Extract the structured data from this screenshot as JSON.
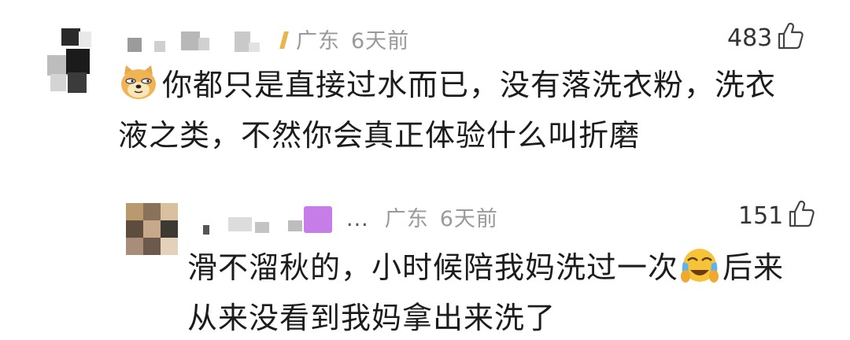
{
  "comments": [
    {
      "location": "广东",
      "time": "6天前",
      "likes": "483",
      "text_line1": "你都只是直接过水而已，没有落洗衣粉，洗衣",
      "text_line2": "液之类，不然你会真正体验什么叫折磨",
      "leading_emoji": "doge-emoji-icon"
    }
  ],
  "reply": {
    "ellipsis": "...",
    "location": "广东",
    "time": "6天前",
    "likes": "151",
    "text_line1_a": "滑不溜秋的，小时候陪我妈洗过一次",
    "text_line1_b": "后来",
    "text_line2": "从来没看到我妈拿出来洗了",
    "inline_emoji": "crying-face-emoji-icon"
  },
  "colors": {
    "meta_gray": "#9a9a9a",
    "text_dark": "#1c1c1c",
    "username_blur_purple": "#c77de8"
  }
}
